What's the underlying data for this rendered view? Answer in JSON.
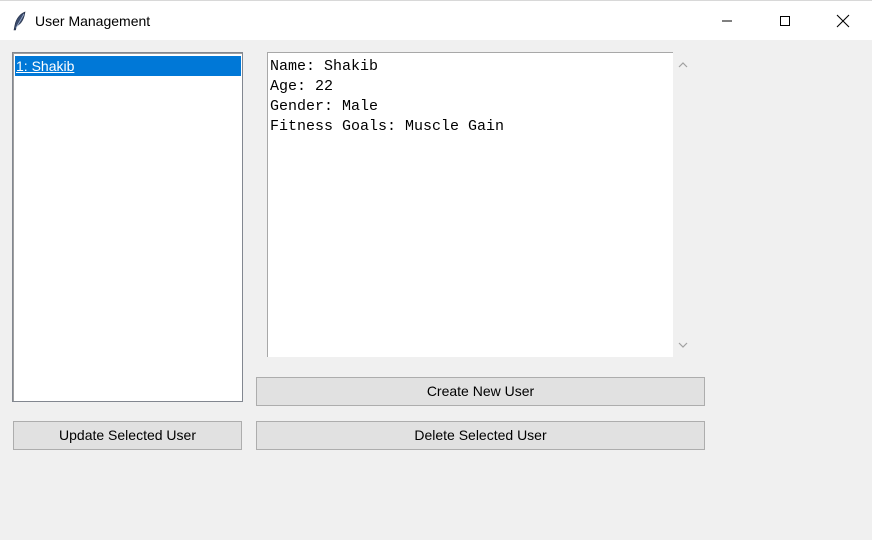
{
  "window": {
    "title": "User Management",
    "icon": "feather-icon",
    "controls": {
      "minimize": "minimize-icon",
      "maximize": "maximize-icon",
      "close": "close-icon"
    }
  },
  "user_list": {
    "items": [
      {
        "label": "1: Shakib",
        "selected": true
      }
    ],
    "selection_color": "#0078d7"
  },
  "details": {
    "lines": [
      "Name: Shakib",
      "Age: 22",
      "Gender: Male",
      "Fitness Goals: Muscle Gain"
    ]
  },
  "buttons": {
    "create": "Create New User",
    "update": "Update Selected User",
    "delete": "Delete Selected User"
  }
}
